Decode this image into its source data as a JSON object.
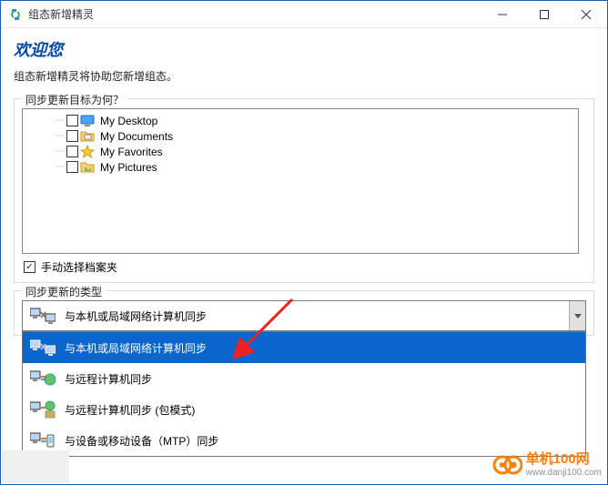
{
  "window": {
    "title": "组态新增精灵"
  },
  "header": {
    "welcome": "欢迎您"
  },
  "subtitle": "组态新增精灵将协助您新增组态。",
  "target_group": {
    "legend": "同步更新目标为何？",
    "items": [
      {
        "label": "My Desktop"
      },
      {
        "label": "My Documents"
      },
      {
        "label": "My Favorites"
      },
      {
        "label": "My Pictures"
      }
    ],
    "manual_select_label": "手动选择档案夹"
  },
  "type_group": {
    "legend": "同步更新的类型",
    "selected_label": "与本机或局域网络计算机同步",
    "options": [
      {
        "label": "与本机或局域网络计算机同步"
      },
      {
        "label": "与远程计算机同步"
      },
      {
        "label": "与远程计算机同步 (包模式)"
      },
      {
        "label": "与设备或移动设备（MTP）同步"
      }
    ]
  },
  "watermark": {
    "line1": "单机100网",
    "line2": "www.danji100.com"
  }
}
